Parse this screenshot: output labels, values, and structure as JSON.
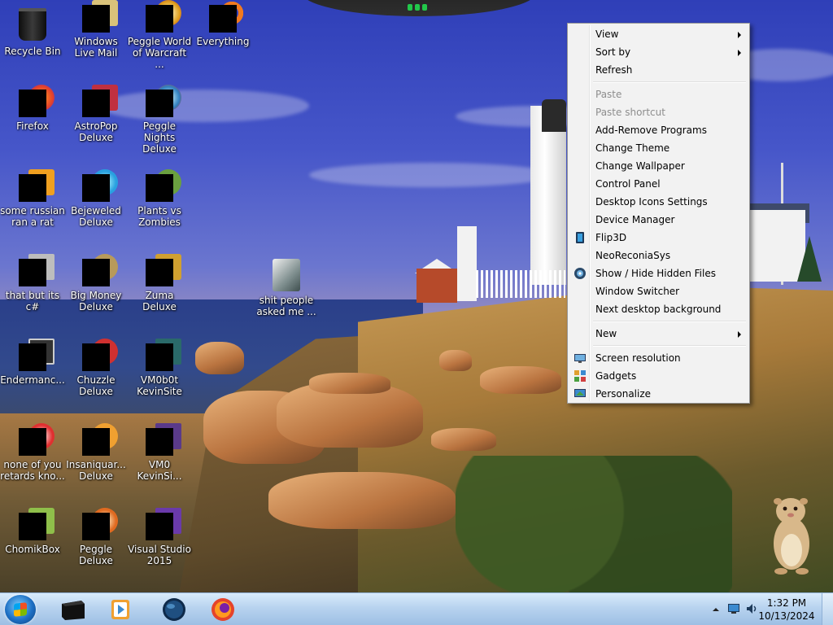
{
  "desktop": {
    "icons": [
      {
        "label": "Recycle Bin",
        "icon": "recycle-bin-icon"
      },
      {
        "label": "Windows Live Mail",
        "icon": "windows-live-mail-icon"
      },
      {
        "label": "Peggle World of Warcraft ...",
        "icon": "peggle-wow-icon"
      },
      {
        "label": "Everything",
        "icon": "everything-icon"
      },
      {
        "label": "Firefox",
        "icon": "firefox-icon"
      },
      {
        "label": "AstroPop Deluxe",
        "icon": "astropop-icon"
      },
      {
        "label": "Peggle Nights Deluxe",
        "icon": "peggle-nights-icon"
      },
      {
        "label": "some russian ran a rat",
        "icon": "app-icon"
      },
      {
        "label": "Bejeweled Deluxe",
        "icon": "bejeweled-icon"
      },
      {
        "label": "Plants vs Zombies",
        "icon": "plants-vs-zombies-icon"
      },
      {
        "label": "that but its c#",
        "icon": "app-icon"
      },
      {
        "label": "Big Money Deluxe",
        "icon": "big-money-icon"
      },
      {
        "label": "Zuma Deluxe",
        "icon": "zuma-icon"
      },
      {
        "label": "shit people asked me ...",
        "icon": "folder-icon"
      },
      {
        "label": "Endermanc...",
        "icon": "app-icon"
      },
      {
        "label": "Chuzzle Deluxe",
        "icon": "chuzzle-icon"
      },
      {
        "label": "VM0b0t KevinSite",
        "icon": "app-icon"
      },
      {
        "label": "none of you retards kno...",
        "icon": "app-icon"
      },
      {
        "label": "Insaniquar... Deluxe",
        "icon": "insaniquarium-icon"
      },
      {
        "label": "VM0 KevinSi...",
        "icon": "app-icon"
      },
      {
        "label": "ChomikBox",
        "icon": "chomikbox-icon"
      },
      {
        "label": "Peggle Deluxe",
        "icon": "peggle-icon"
      },
      {
        "label": "Visual Studio 2015",
        "icon": "visual-studio-icon"
      }
    ]
  },
  "context_menu": {
    "view": "View",
    "sort_by": "Sort by",
    "refresh": "Refresh",
    "paste": "Paste",
    "paste_shortcut": "Paste shortcut",
    "add_remove": "Add-Remove Programs",
    "change_theme": "Change Theme",
    "change_wallpaper": "Change Wallpaper",
    "control_panel": "Control Panel",
    "desktop_icons_settings": "Desktop Icons Settings",
    "device_manager": "Device Manager",
    "flip3d": "Flip3D",
    "neoreconiasys": "NeoReconiaSys",
    "show_hide_hidden": "Show / Hide Hidden Files",
    "window_switcher": "Window Switcher",
    "next_background": "Next desktop background",
    "new": "New",
    "screen_resolution": "Screen resolution",
    "gadgets": "Gadgets",
    "personalize": "Personalize"
  },
  "taskbar": {
    "pinned": [
      "terminal-icon",
      "media-player-icon",
      "globe-icon",
      "firefox-icon"
    ],
    "clock_time": "1:32 PM",
    "clock_date": "10/13/2024"
  }
}
